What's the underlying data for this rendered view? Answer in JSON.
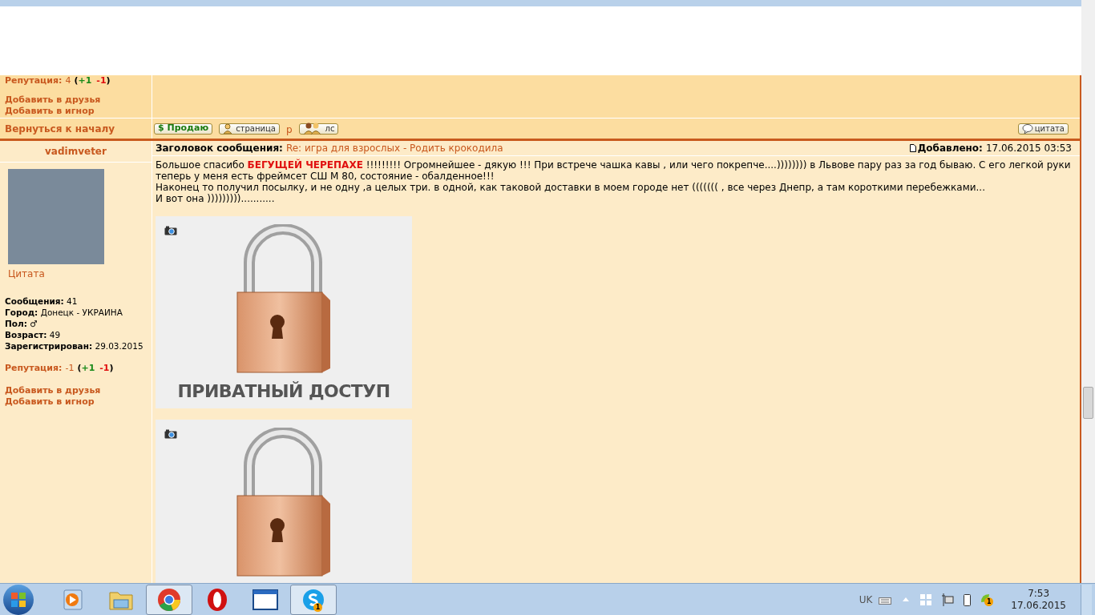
{
  "prev_post": {
    "reputation_label": "Репутация:",
    "reputation_value": "4",
    "open": "(",
    "plus": "+1",
    "minus": "-1",
    "close": ")",
    "links": [
      "Добавить в друзья",
      "Добавить в игнор"
    ]
  },
  "action_row": {
    "back_link": "Вернуться к началу",
    "buttons": [
      {
        "kind": "sell",
        "label": "$ Продаю"
      },
      {
        "kind": "page",
        "label": "страница"
      },
      {
        "kind": "letter",
        "label": "р"
      },
      {
        "kind": "pm",
        "label": "лс"
      }
    ],
    "quote_button": "цитата"
  },
  "post": {
    "author": "vadimveter",
    "quote_link": "Цитата",
    "stats": [
      {
        "label": "Сообщения:",
        "value": "41"
      },
      {
        "label": "Город:",
        "value": "Донецк - УКРАИНА"
      },
      {
        "label": "Пол:",
        "value": "♂"
      },
      {
        "label": "Возраст:",
        "value": "49"
      },
      {
        "label": "Зарегистрирован:",
        "value": "29.03.2015"
      }
    ],
    "reputation_label": "Репутация:",
    "reputation_value": "-1",
    "open": "(",
    "plus": "+1",
    "minus": "-1",
    "close": ")",
    "links": [
      "Добавить в друзья",
      "Добавить в игнор"
    ],
    "subject_label": "Заголовок сообщения:",
    "subject": "Re: игра для взрослых - Родить крокодила",
    "added_label": "Добавлено:",
    "added": "17.06.2015 03:53",
    "paragraphs": [
      "Большое спасибо **БЕГУЩЕЙ ЧЕРЕПАХЕ** !!!!!!!!! Огромнейшее - дякую !!! При встрече чашка кавы , или чего покрепче....)))))))) в Львове пару раз за год бываю. С его легкой руки теперь у меня есть фреймсет СШ М 80, состояние - обалденное!!!",
      "Наконец то получил посылку, и не одну ,а целых три. в одной, как таковой доставки в моем городе нет ((((((( , все через Днепр, а там короткими перебежками...",
      "И вот она )))))))))..........."
    ],
    "images": [
      {
        "kind": "lock",
        "caption": "ПРИВАТНЫЙ ДОСТУП"
      },
      {
        "kind": "lock"
      }
    ]
  },
  "taskbar": {
    "apps": [
      {
        "kind": "media",
        "selected": false
      },
      {
        "kind": "folder",
        "selected": false
      },
      {
        "kind": "chrome",
        "selected": true
      },
      {
        "kind": "opera",
        "selected": false
      },
      {
        "kind": "window",
        "selected": false
      },
      {
        "kind": "skype",
        "selected": true,
        "badge": "1"
      }
    ],
    "tray": {
      "language": "UK",
      "badge": "1",
      "time": "7:53",
      "date": "17.06.2015"
    }
  }
}
